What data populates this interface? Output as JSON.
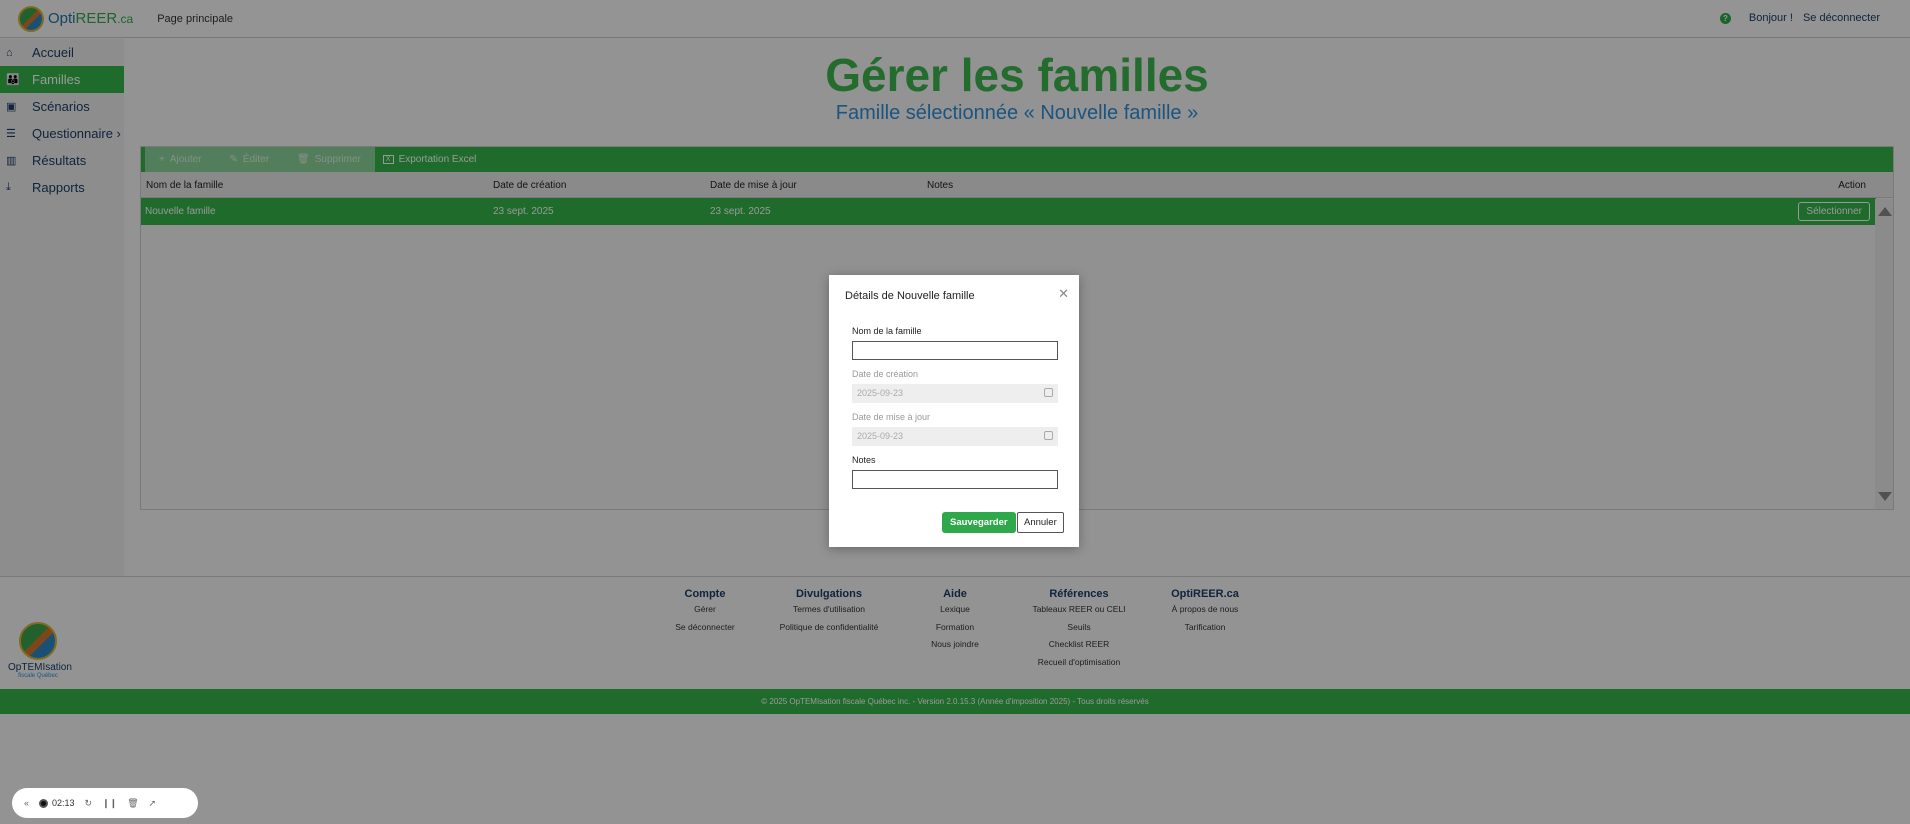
{
  "header": {
    "brand_prefix": "Opti",
    "brand_main": "REER",
    "brand_suffix": ".ca",
    "nav_home": "Page principale",
    "help": "?",
    "greeting": "Bonjour !",
    "logout": "Se déconnecter"
  },
  "sidebar": {
    "items": [
      {
        "icon": "home-icon",
        "glyph": "⌂",
        "label": "Accueil"
      },
      {
        "icon": "people-icon",
        "glyph": "👪",
        "label": "Familles",
        "active": true
      },
      {
        "icon": "image-icon",
        "glyph": "▣",
        "label": "Scénarios"
      },
      {
        "icon": "document-icon",
        "glyph": "☰",
        "label": "Questionnaire ›"
      },
      {
        "icon": "bar-chart-icon",
        "glyph": "▥",
        "label": "Résultats"
      },
      {
        "icon": "download-icon",
        "glyph": "⤓",
        "label": "Rapports"
      }
    ]
  },
  "page": {
    "title": "Gérer les familles",
    "subtitle": "Famille sélectionnée « Nouvelle famille »"
  },
  "toolbar": {
    "add": "Ajouter",
    "edit": "Éditer",
    "delete": "Supprimer",
    "export": "Exportation Excel"
  },
  "table": {
    "columns": [
      "Nom de la famille",
      "Date de création",
      "Date de mise à jour",
      "Notes",
      "Action"
    ],
    "rows": [
      {
        "name": "Nouvelle famille",
        "created": "23 sept. 2025",
        "updated": "23 sept. 2025",
        "notes": "",
        "action": "Sélectionner"
      }
    ]
  },
  "modal": {
    "title": "Détails de Nouvelle famille",
    "name_label": "Nom de la famille",
    "name_value": "",
    "created_label": "Date de création",
    "created_value": "2025-09-23",
    "updated_label": "Date de mise à jour",
    "updated_value": "2025-09-23",
    "notes_label": "Notes",
    "notes_value": "",
    "save": "Sauvegarder",
    "cancel": "Annuler"
  },
  "footer": {
    "logo_text": "OpTEMIsation",
    "logo_sub": "fiscale Québec",
    "columns": [
      {
        "title": "Compte",
        "links": [
          "Gérer",
          "Se déconnecter"
        ]
      },
      {
        "title": "Divulgations",
        "links": [
          "Termes d'utilisation",
          "Politique de confidentialité"
        ]
      },
      {
        "title": "Aide",
        "links": [
          "Lexique",
          "Formation",
          "Nous joindre"
        ]
      },
      {
        "title": "Références",
        "links": [
          "Tableaux REER ou CELI",
          "Seuils",
          "Checklist REER",
          "Recueil d'optimisation"
        ]
      },
      {
        "title": "OptiREER.ca",
        "links": [
          "À propos de nous",
          "Tarification"
        ]
      }
    ],
    "copyright": "© 2025 OpTEMIsation fiscale Québec inc. - Version 2.0.15.3 (Année d'imposition 2025) - Tous droits réservés"
  },
  "recorder": {
    "time": "02:13"
  }
}
